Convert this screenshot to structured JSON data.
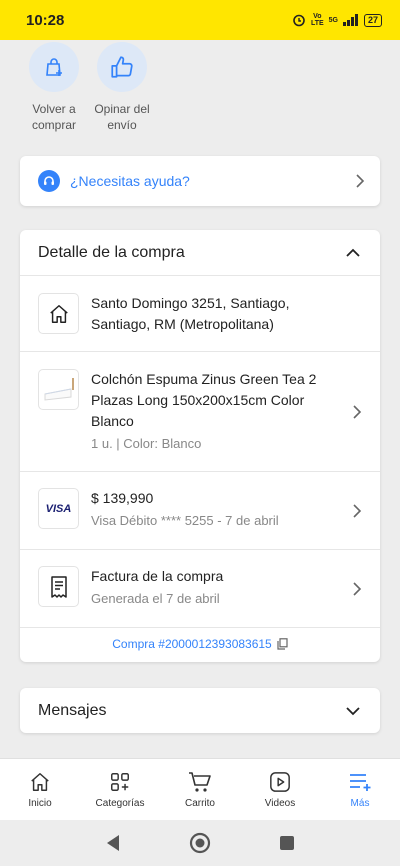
{
  "status_bar": {
    "time": "10:28",
    "net_top": "Vo",
    "net_bottom": "LTE",
    "gen": "5G",
    "battery": "27"
  },
  "quick_actions": [
    {
      "label": "Volver a comprar",
      "icon": "bag-add-icon"
    },
    {
      "label": "Opinar del envío",
      "icon": "thumbs-up-icon"
    }
  ],
  "help": {
    "label": "¿Necesitas ayuda?"
  },
  "detail": {
    "title": "Detalle de la compra",
    "address": "Santo Domingo 3251, Santiago, Santiago, RM (Metropolitana)",
    "product": {
      "title": "Colchón Espuma Zinus Green Tea 2 Plazas Long 150x200x15cm Color Blanco",
      "sub": "1 u. | Color: Blanco"
    },
    "payment": {
      "brand": "VISA",
      "amount": "$ 139,990",
      "sub": "Visa Débito **** 5255 - 7 de abril"
    },
    "invoice": {
      "title": "Factura de la compra",
      "sub": "Generada el 7 de abril"
    },
    "order": "Compra #2000012393083615"
  },
  "messages": {
    "title": "Mensajes"
  },
  "bottom_nav": [
    {
      "label": "Inicio",
      "icon": "home-icon"
    },
    {
      "label": "Categorías",
      "icon": "categories-icon"
    },
    {
      "label": "Carrito",
      "icon": "cart-icon"
    },
    {
      "label": "Videos",
      "icon": "video-icon"
    },
    {
      "label": "Más",
      "icon": "menu-plus-icon"
    }
  ],
  "colors": {
    "brand_yellow": "#ffe600",
    "accent_blue": "#3483fa"
  }
}
